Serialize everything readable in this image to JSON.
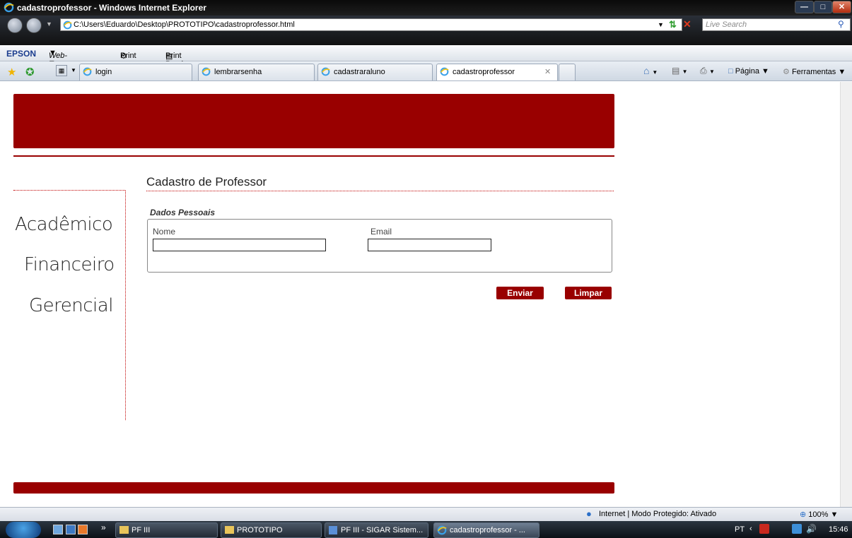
{
  "window": {
    "title": "cadastroprofessor - Windows Internet Explorer"
  },
  "address_bar": {
    "url": "C:\\Users\\Eduardo\\Desktop\\PROTOTIPO\\cadastroprofessor.html",
    "search_placeholder": "Live Search"
  },
  "epson_toolbar": {
    "brand": "EPSON",
    "web_to_page": "Web-To-Page",
    "print": "Print",
    "print_preview": "Print Preview"
  },
  "tabs": [
    {
      "label": "login"
    },
    {
      "label": "lembrarsenha"
    },
    {
      "label": "cadastraraluno"
    },
    {
      "label": "cadastroprofessor",
      "active": true
    }
  ],
  "command_bar": {
    "page": "Página",
    "tools": "Ferramentas"
  },
  "sidebar": {
    "items": [
      "Acadêmico",
      "Financeiro",
      "Gerencial"
    ]
  },
  "form": {
    "title": "Cadastro de Professor",
    "section": "Dados Pessoais",
    "fields": [
      {
        "label": "Nome",
        "value": ""
      },
      {
        "label": "Email",
        "value": ""
      }
    ],
    "submit_label": "Enviar",
    "clear_label": "Limpar"
  },
  "status_bar": {
    "zone": "Internet | Modo Protegido: Ativado",
    "zoom": "100%"
  },
  "taskbar": {
    "items": [
      "PF III",
      "PROTOTIPO",
      "PF III - SIGAR Sistem...",
      "cadastroprofessor - ..."
    ],
    "language": "PT",
    "time": "15:46"
  },
  "colors": {
    "brand_red": "#990000",
    "dotted_rule": "#c00000"
  }
}
